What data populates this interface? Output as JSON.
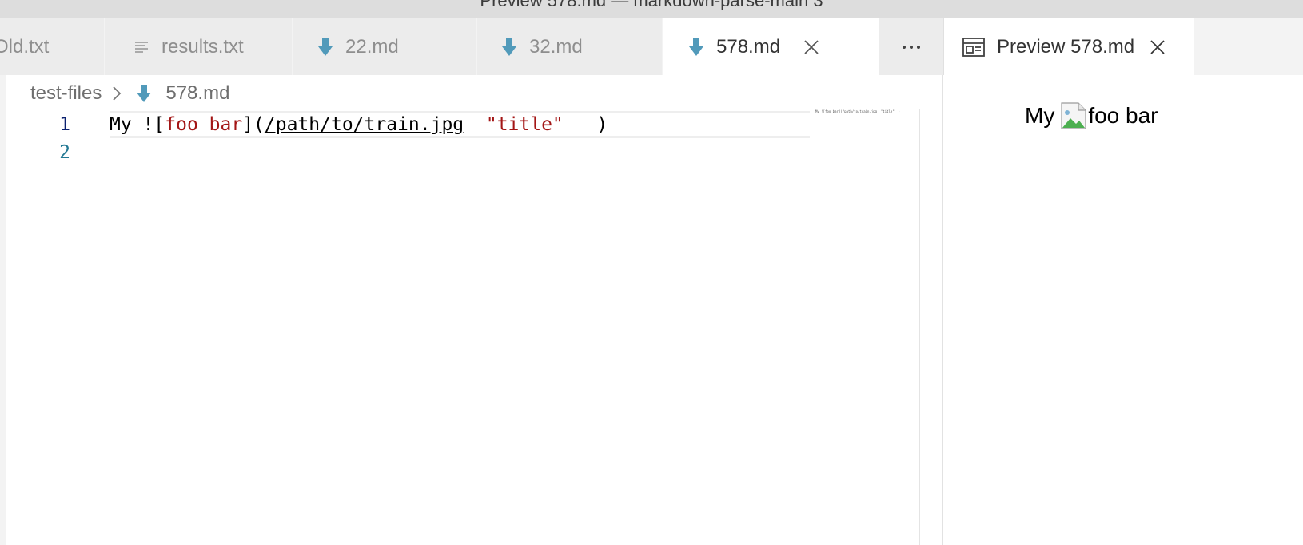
{
  "window": {
    "title": "Preview 578.md — markdown-parse-main 3"
  },
  "tabs": [
    {
      "label": "Old.txt",
      "icon": "none",
      "active": false
    },
    {
      "label": "results.txt",
      "icon": "text-lines-icon",
      "active": false
    },
    {
      "label": "22.md",
      "icon": "markdown-arrow-icon",
      "active": false
    },
    {
      "label": "32.md",
      "icon": "markdown-arrow-icon",
      "active": false
    },
    {
      "label": "578.md",
      "icon": "markdown-arrow-icon",
      "active": true
    }
  ],
  "more_actions_label": "···",
  "preview_tab": {
    "label": "Preview 578.md",
    "icon": "preview-icon"
  },
  "breadcrumb": {
    "folder": "test-files",
    "file": "578.md"
  },
  "editor": {
    "line_numbers": [
      "1",
      "2"
    ],
    "code_line": {
      "plain_start": "My ![",
      "alt_text": "foo bar",
      "bracket_open": "](",
      "url": "/path/to/train.jpg",
      "spacer": "  ",
      "title": "\"title\"",
      "close": "   )"
    },
    "minimap_text": "My ![foo bar](/path/to/train.jpg  \"title\"  )"
  },
  "preview": {
    "text_before": "My",
    "image_alt": "foo bar"
  },
  "colors": {
    "accent_icon": "#519aba",
    "string_red": "#a31515",
    "line_number_active": "#0b216f",
    "line_number": "#237893"
  }
}
